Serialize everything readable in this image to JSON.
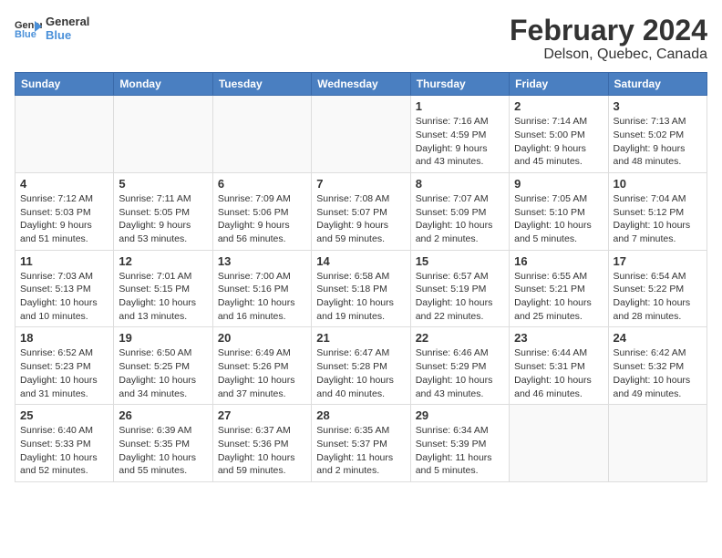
{
  "logo": {
    "line1": "General",
    "line2": "Blue"
  },
  "title": "February 2024",
  "subtitle": "Delson, Quebec, Canada",
  "weekdays": [
    "Sunday",
    "Monday",
    "Tuesday",
    "Wednesday",
    "Thursday",
    "Friday",
    "Saturday"
  ],
  "weeks": [
    [
      {
        "day": "",
        "detail": ""
      },
      {
        "day": "",
        "detail": ""
      },
      {
        "day": "",
        "detail": ""
      },
      {
        "day": "",
        "detail": ""
      },
      {
        "day": "1",
        "detail": "Sunrise: 7:16 AM\nSunset: 4:59 PM\nDaylight: 9 hours\nand 43 minutes."
      },
      {
        "day": "2",
        "detail": "Sunrise: 7:14 AM\nSunset: 5:00 PM\nDaylight: 9 hours\nand 45 minutes."
      },
      {
        "day": "3",
        "detail": "Sunrise: 7:13 AM\nSunset: 5:02 PM\nDaylight: 9 hours\nand 48 minutes."
      }
    ],
    [
      {
        "day": "4",
        "detail": "Sunrise: 7:12 AM\nSunset: 5:03 PM\nDaylight: 9 hours\nand 51 minutes."
      },
      {
        "day": "5",
        "detail": "Sunrise: 7:11 AM\nSunset: 5:05 PM\nDaylight: 9 hours\nand 53 minutes."
      },
      {
        "day": "6",
        "detail": "Sunrise: 7:09 AM\nSunset: 5:06 PM\nDaylight: 9 hours\nand 56 minutes."
      },
      {
        "day": "7",
        "detail": "Sunrise: 7:08 AM\nSunset: 5:07 PM\nDaylight: 9 hours\nand 59 minutes."
      },
      {
        "day": "8",
        "detail": "Sunrise: 7:07 AM\nSunset: 5:09 PM\nDaylight: 10 hours\nand 2 minutes."
      },
      {
        "day": "9",
        "detail": "Sunrise: 7:05 AM\nSunset: 5:10 PM\nDaylight: 10 hours\nand 5 minutes."
      },
      {
        "day": "10",
        "detail": "Sunrise: 7:04 AM\nSunset: 5:12 PM\nDaylight: 10 hours\nand 7 minutes."
      }
    ],
    [
      {
        "day": "11",
        "detail": "Sunrise: 7:03 AM\nSunset: 5:13 PM\nDaylight: 10 hours\nand 10 minutes."
      },
      {
        "day": "12",
        "detail": "Sunrise: 7:01 AM\nSunset: 5:15 PM\nDaylight: 10 hours\nand 13 minutes."
      },
      {
        "day": "13",
        "detail": "Sunrise: 7:00 AM\nSunset: 5:16 PM\nDaylight: 10 hours\nand 16 minutes."
      },
      {
        "day": "14",
        "detail": "Sunrise: 6:58 AM\nSunset: 5:18 PM\nDaylight: 10 hours\nand 19 minutes."
      },
      {
        "day": "15",
        "detail": "Sunrise: 6:57 AM\nSunset: 5:19 PM\nDaylight: 10 hours\nand 22 minutes."
      },
      {
        "day": "16",
        "detail": "Sunrise: 6:55 AM\nSunset: 5:21 PM\nDaylight: 10 hours\nand 25 minutes."
      },
      {
        "day": "17",
        "detail": "Sunrise: 6:54 AM\nSunset: 5:22 PM\nDaylight: 10 hours\nand 28 minutes."
      }
    ],
    [
      {
        "day": "18",
        "detail": "Sunrise: 6:52 AM\nSunset: 5:23 PM\nDaylight: 10 hours\nand 31 minutes."
      },
      {
        "day": "19",
        "detail": "Sunrise: 6:50 AM\nSunset: 5:25 PM\nDaylight: 10 hours\nand 34 minutes."
      },
      {
        "day": "20",
        "detail": "Sunrise: 6:49 AM\nSunset: 5:26 PM\nDaylight: 10 hours\nand 37 minutes."
      },
      {
        "day": "21",
        "detail": "Sunrise: 6:47 AM\nSunset: 5:28 PM\nDaylight: 10 hours\nand 40 minutes."
      },
      {
        "day": "22",
        "detail": "Sunrise: 6:46 AM\nSunset: 5:29 PM\nDaylight: 10 hours\nand 43 minutes."
      },
      {
        "day": "23",
        "detail": "Sunrise: 6:44 AM\nSunset: 5:31 PM\nDaylight: 10 hours\nand 46 minutes."
      },
      {
        "day": "24",
        "detail": "Sunrise: 6:42 AM\nSunset: 5:32 PM\nDaylight: 10 hours\nand 49 minutes."
      }
    ],
    [
      {
        "day": "25",
        "detail": "Sunrise: 6:40 AM\nSunset: 5:33 PM\nDaylight: 10 hours\nand 52 minutes."
      },
      {
        "day": "26",
        "detail": "Sunrise: 6:39 AM\nSunset: 5:35 PM\nDaylight: 10 hours\nand 55 minutes."
      },
      {
        "day": "27",
        "detail": "Sunrise: 6:37 AM\nSunset: 5:36 PM\nDaylight: 10 hours\nand 59 minutes."
      },
      {
        "day": "28",
        "detail": "Sunrise: 6:35 AM\nSunset: 5:37 PM\nDaylight: 11 hours\nand 2 minutes."
      },
      {
        "day": "29",
        "detail": "Sunrise: 6:34 AM\nSunset: 5:39 PM\nDaylight: 11 hours\nand 5 minutes."
      },
      {
        "day": "",
        "detail": ""
      },
      {
        "day": "",
        "detail": ""
      }
    ]
  ]
}
